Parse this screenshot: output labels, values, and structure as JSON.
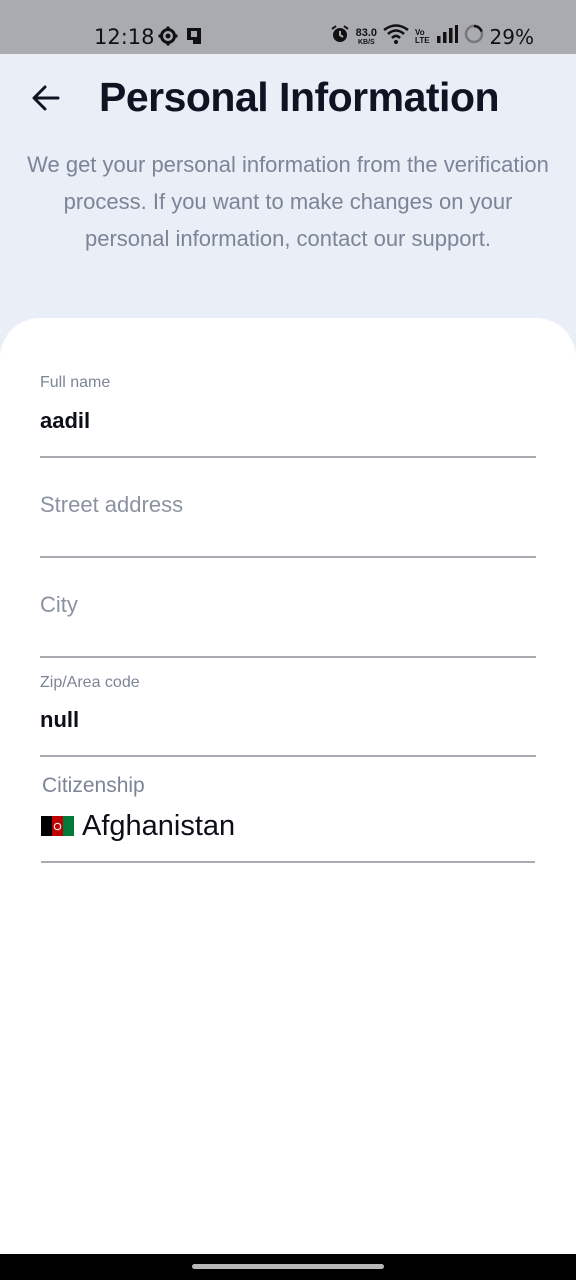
{
  "status_bar": {
    "time": "12:18",
    "net_speed_value": "83.0",
    "net_speed_unit": "KB/S",
    "volte_top": "Vo",
    "volte_bottom": "LTE",
    "battery_percent": "29%"
  },
  "header": {
    "title": "Personal Information",
    "subtitle": "We get your personal information from the verification process. If you want to make changes on your personal information, contact our support."
  },
  "form": {
    "full_name": {
      "label": "Full name",
      "value": "aadil"
    },
    "street_address": {
      "placeholder": "Street address"
    },
    "city": {
      "placeholder": "City"
    },
    "zip": {
      "label": "Zip/Area code",
      "value": "null"
    },
    "citizenship": {
      "label": "Citizenship",
      "value": "Afghanistan"
    }
  },
  "colors": {
    "background": "#eaeef6",
    "card": "#ffffff",
    "title_text": "#0f1322",
    "muted_text": "#7c8597",
    "underline": "#a8abb1",
    "flag_black": "#000000",
    "flag_red": "#be0000",
    "flag_green": "#007a36"
  },
  "icons": [
    "gear-icon",
    "sim-card-icon",
    "alarm-icon",
    "wifi-icon",
    "signal-icon",
    "battery-ring-icon",
    "back-arrow-icon",
    "afghanistan-flag-icon"
  ]
}
